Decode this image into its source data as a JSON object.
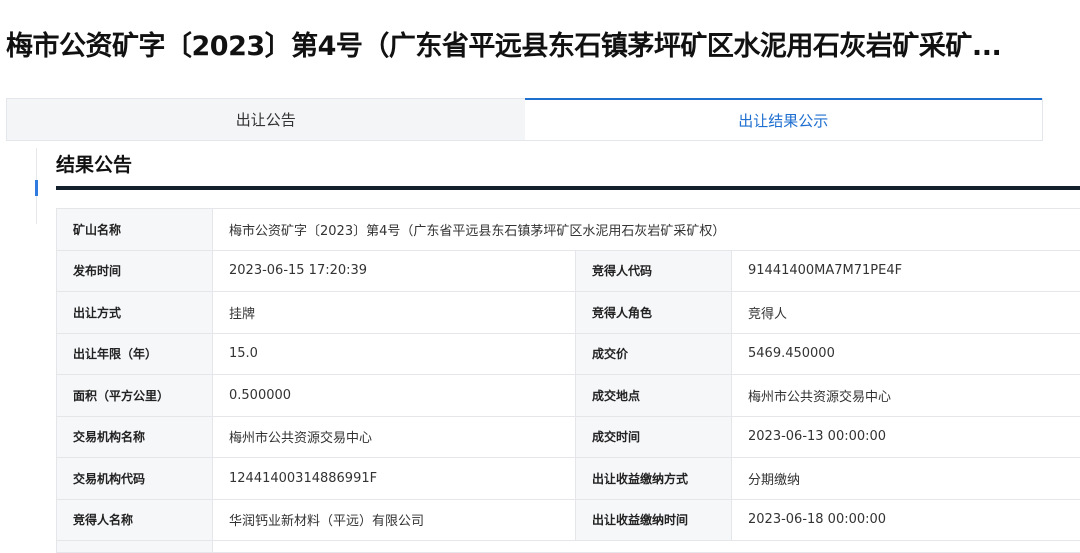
{
  "page": {
    "title": "梅市公资矿字〔2023〕第4号（广东省平远县东石镇茅坪矿区水泥用石灰岩矿采矿..."
  },
  "tabs": [
    {
      "label": "出让公告",
      "active": false
    },
    {
      "label": "出让结果公示",
      "active": true
    }
  ],
  "section": {
    "title": "结果公告"
  },
  "table": {
    "mine_name": {
      "label": "矿山名称",
      "value": "梅市公资矿字〔2023〕第4号（广东省平远县东石镇茅坪矿区水泥用石灰岩矿采矿权）"
    },
    "rows": [
      {
        "label1": "发布时间",
        "value1": "2023-06-15 17:20:39",
        "label2": "竞得人代码",
        "value2": "91441400MA7M71PE4F"
      },
      {
        "label1": "出让方式",
        "value1": "挂牌",
        "label2": "竞得人角色",
        "value2": "竞得人"
      },
      {
        "label1": "出让年限（年）",
        "value1": "15.0",
        "label2": "成交价",
        "value2": "5469.450000"
      },
      {
        "label1": "面积（平方公里）",
        "value1": "0.500000",
        "label2": "成交地点",
        "value2": "梅州市公共资源交易中心"
      },
      {
        "label1": "交易机构名称",
        "value1": "梅州市公共资源交易中心",
        "label2": "成交时间",
        "value2": "2023-06-13 00:00:00"
      },
      {
        "label1": "交易机构代码",
        "value1": "12441400314886991F",
        "label2": "出让收益缴纳方式",
        "value2": "分期缴纳"
      },
      {
        "label1": "竞得人名称",
        "value1": "华润钙业新材料（平远）有限公司",
        "label2": "出让收益缴纳时间",
        "value2": "2023-06-18 00:00:00"
      }
    ]
  },
  "colors": {
    "accent": "#1f6fd0",
    "title_rule": "#15202d",
    "label_bg": "#f6f7f9"
  }
}
